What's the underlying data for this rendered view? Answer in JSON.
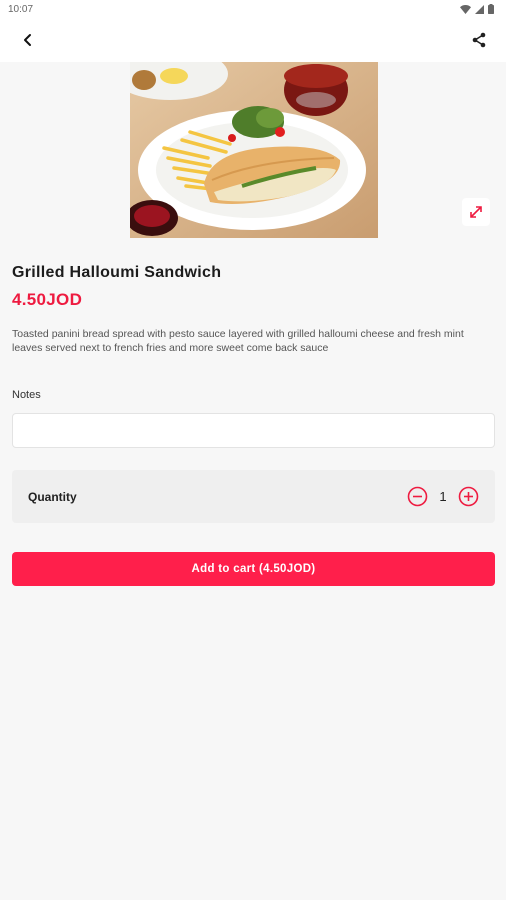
{
  "status_bar": {
    "time": "10:07"
  },
  "app_bar": {
    "back_icon": "arrow-back-icon",
    "share_icon": "share-icon"
  },
  "product": {
    "image_alt": "Grilled Halloumi Sandwich photo",
    "name": "Grilled Halloumi Sandwich",
    "price": "4.50JOD",
    "description": "Toasted panini bread spread with pesto sauce layered with grilled halloumi cheese and fresh mint leaves served next to french fries and more sweet come back sauce"
  },
  "notes": {
    "label": "Notes",
    "value": "",
    "placeholder": ""
  },
  "quantity": {
    "label": "Quantity",
    "value": "1"
  },
  "cart": {
    "button_label": "Add to cart (4.50JOD)"
  },
  "colors": {
    "accent": "#ff1f4b",
    "price": "#ee1b40",
    "background": "#f7f7f7"
  }
}
